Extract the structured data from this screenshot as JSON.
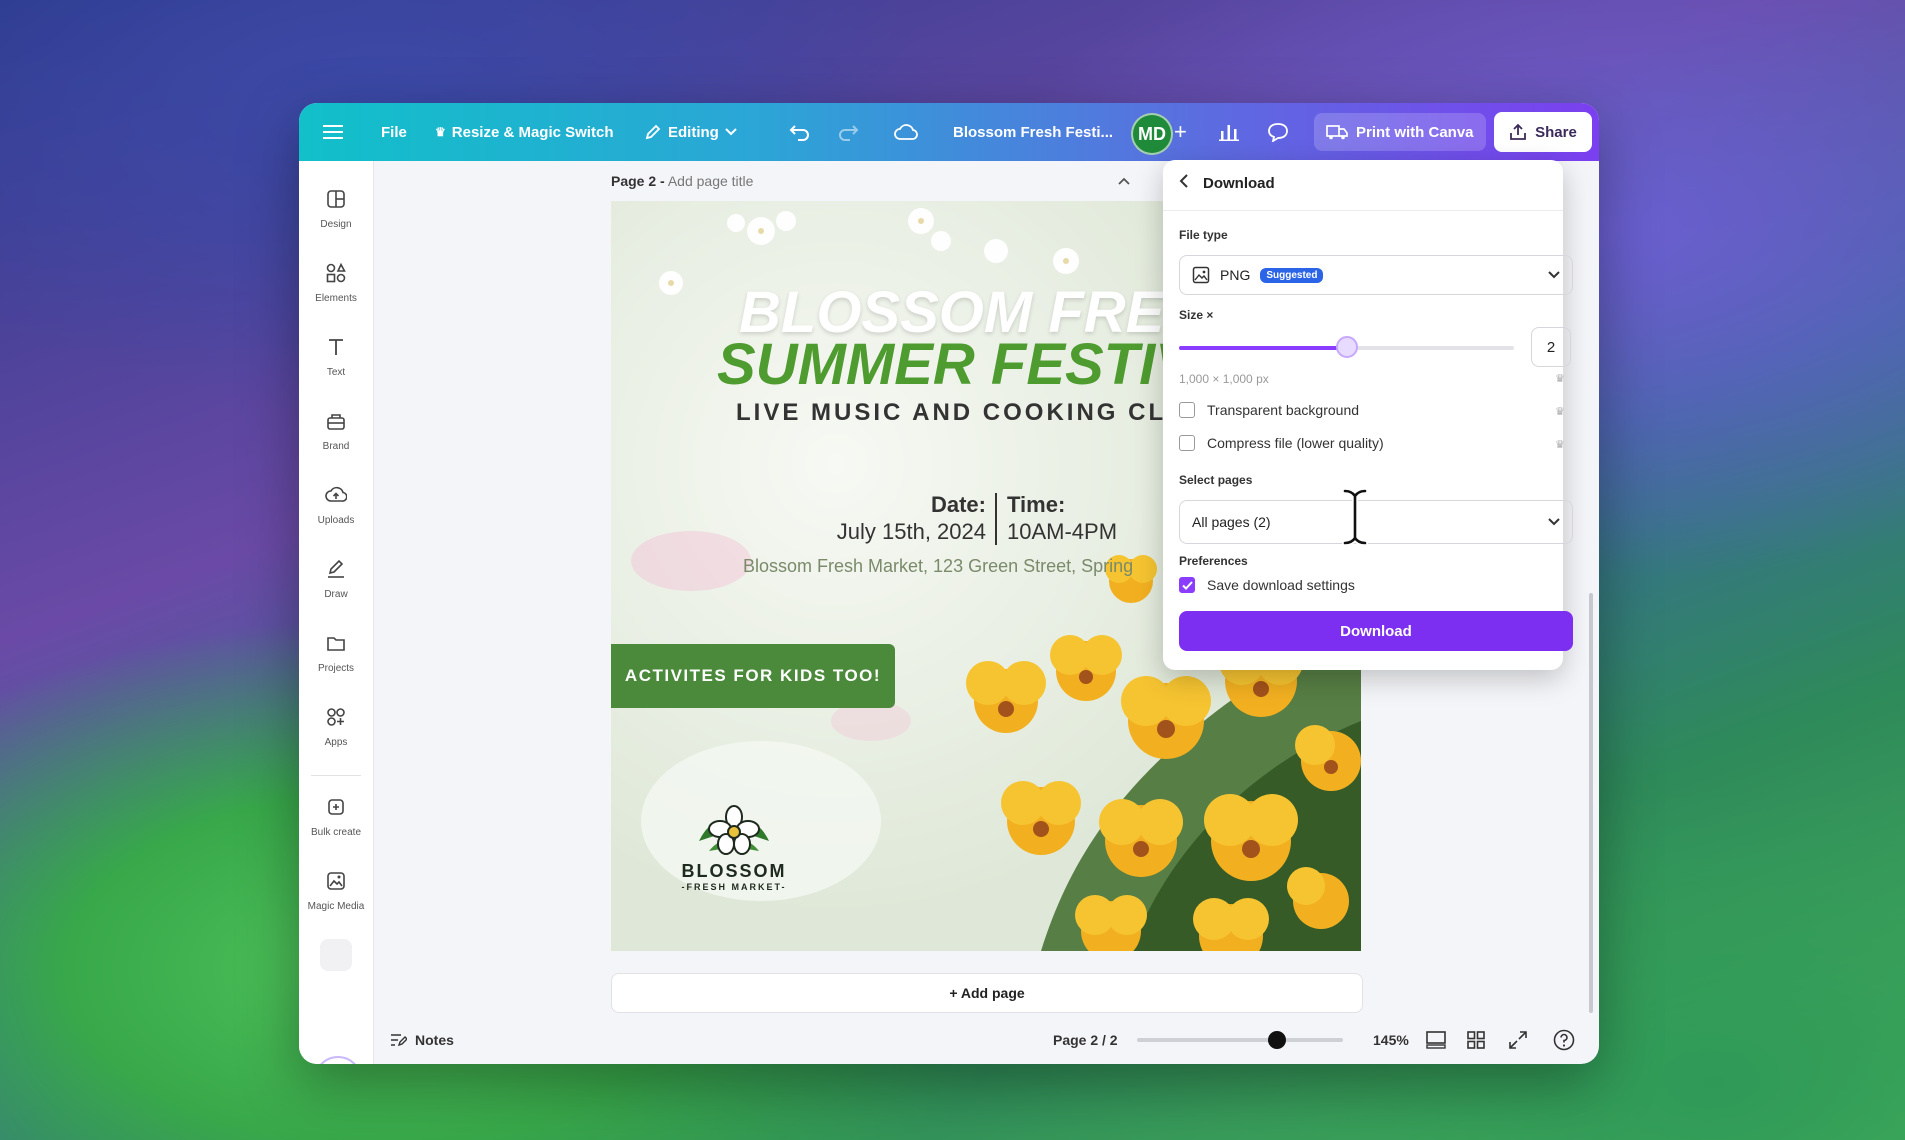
{
  "topbar": {
    "file": "File",
    "resize": "Resize & Magic Switch",
    "editing": "Editing",
    "doc_title": "Blossom Fresh Festi...",
    "avatar_initials": "MD",
    "print": "Print with Canva",
    "share": "Share"
  },
  "sidebar": {
    "items": [
      {
        "label": "Design",
        "icon": "design-icon"
      },
      {
        "label": "Elements",
        "icon": "elements-icon"
      },
      {
        "label": "Text",
        "icon": "text-icon"
      },
      {
        "label": "Brand",
        "icon": "brand-icon"
      },
      {
        "label": "Uploads",
        "icon": "uploads-icon"
      },
      {
        "label": "Draw",
        "icon": "draw-icon"
      },
      {
        "label": "Projects",
        "icon": "projects-icon"
      },
      {
        "label": "Apps",
        "icon": "apps-icon"
      },
      {
        "label": "Bulk create",
        "icon": "bulk-create-icon"
      },
      {
        "label": "Magic Media",
        "icon": "magic-media-icon"
      }
    ]
  },
  "page": {
    "label": "Page 2 -",
    "add_title": "Add page title",
    "add_page": "+ Add page"
  },
  "design": {
    "title_line1": "BLOSSOM FRES",
    "title_line2": "SUMMER FESTIV",
    "subtitle": "LIVE MUSIC AND COOKING CLA",
    "date_label": "Date:",
    "date_value": "July 15th, 2024",
    "time_label": "Time:",
    "time_value": "10AM-4PM",
    "address": "Blossom Fresh Market, 123 Green Street, Spring",
    "kids_banner": "ACTIVITES FOR KIDS TOO!",
    "logo_name": "BLOSSOM",
    "logo_sub": "-FRESH MARKET-"
  },
  "download_panel": {
    "title": "Download",
    "file_type_label": "File type",
    "file_type_value": "PNG",
    "suggested_badge": "Suggested",
    "size_label": "Size ×",
    "size_value": "2",
    "size_fraction": 0.5,
    "dimensions": "1,000 × 1,000 px",
    "transparent_bg": "Transparent background",
    "compress": "Compress file (lower quality)",
    "select_pages_label": "Select pages",
    "select_pages_value": "All pages (2)",
    "preferences_label": "Preferences",
    "save_settings": "Save download settings",
    "save_settings_checked": true,
    "download_button": "Download"
  },
  "bottombar": {
    "notes": "Notes",
    "page_indicator": "Page 2 / 2",
    "zoom": "145%",
    "zoom_fraction": 0.68
  },
  "colors": {
    "accent": "#8b3dff",
    "topbar_start": "#11c0c9",
    "topbar_end": "#7b3ff0",
    "design_green": "#4e9b2f"
  }
}
